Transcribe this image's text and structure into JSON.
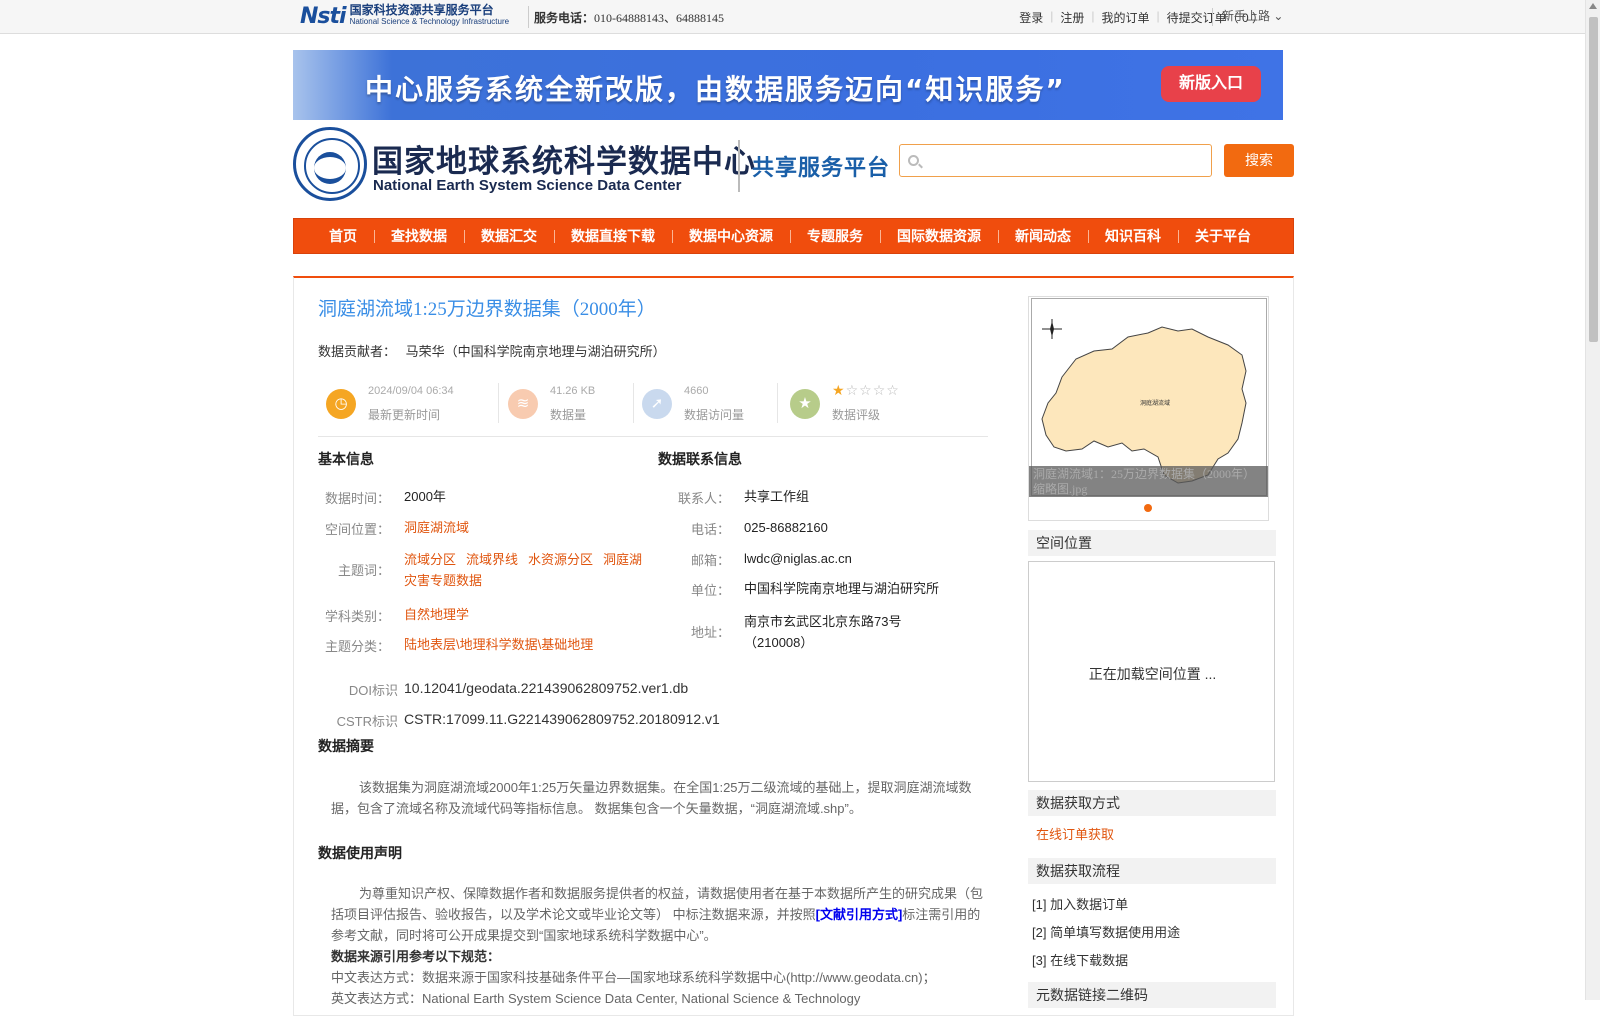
{
  "topbar": {
    "logo_mark": "Nsti",
    "logo_cn": "国家科技资源共享服务平台",
    "logo_en": "National Science & Technology Infrastructure",
    "phone_label": "服务电话：",
    "phone_value": "010-64888143、64888145",
    "links": [
      "登录",
      "注册",
      "我的订单",
      "待提交订单（ 0 ）"
    ],
    "newbie": "新手上路 ⌄"
  },
  "banner": {
    "text": "中心服务系统全新改版，由数据服务迈向“知识服务”",
    "button": "新版入口"
  },
  "brand": {
    "cn": "国家地球系统科学数据中心",
    "en": "National Earth System Science Data Center",
    "sub": "共享服务平台"
  },
  "search": {
    "placeholder": "",
    "button": "搜索"
  },
  "nav": [
    "首页",
    "查找数据",
    "数据汇交",
    "数据直接下载",
    "数据中心资源",
    "专题服务",
    "国际数据资源",
    "新闻动态",
    "知识百科",
    "关于平台"
  ],
  "dataset": {
    "title": "洞庭湖流域1:25万边界数据集（2000年）",
    "contributor_label": "数据贡献者：",
    "contributor": "马荣华（中国科学院南京地理与湖泊研究所）",
    "stats": [
      {
        "value": "2024/09/04 06:34",
        "label": "最新更新时间",
        "icon": "clock-icon",
        "color": "#f5a623"
      },
      {
        "value": "41.26 KB",
        "label": "数据量",
        "icon": "layers-icon",
        "color": "#f8cbb0"
      },
      {
        "value": "4660",
        "label": "数据访问量",
        "icon": "cursor-icon",
        "color": "#c9d9ee"
      },
      {
        "value": "",
        "label": "数据评级",
        "icon": "star-badge-icon",
        "color": "#b7cc8a"
      }
    ],
    "rating": 1,
    "rating_max": 5
  },
  "basic_info": {
    "heading": "基本信息",
    "time_label": "数据时间：",
    "time_value": "2000年",
    "location_label": "空间位置：",
    "location_value": "洞庭湖流域",
    "keywords_label": "主题词：",
    "keywords": [
      "流域分区",
      "流域界线",
      "水资源分区",
      "洞庭湖灾害专题数据"
    ],
    "discipline_label": "学科类别：",
    "discipline_value": "自然地理学",
    "category_label": "主题分类：",
    "category_value": "陆地表层\\地理科学数据\\基础地理",
    "doi_label": "DOI标识",
    "doi_value": "10.12041/geodata.221439062809752.ver1.db",
    "cstr_label": "CSTR标识",
    "cstr_value": "CSTR:17099.11.G221439062809752.20180912.v1"
  },
  "contact_info": {
    "heading": "数据联系信息",
    "contact_label": "联系人：",
    "contact_value": "共享工作组",
    "phone_label": "电话：",
    "phone_value": "025-86882160",
    "email_label": "邮箱：",
    "email_value": "lwdc@niglas.ac.cn",
    "unit_label": "单位：",
    "unit_value": "中国科学院南京地理与湖泊研究所",
    "address_label": "地址：",
    "address_value": "南京市玄武区北京东路73号（210008）"
  },
  "abstract": {
    "heading": "数据摘要",
    "text": "该数据集为洞庭湖流域2000年1:25万矢量边界数据集。在全国1:25万二级流域的基础上，提取洞庭湖流域数据，包含了流域名称及流域代码等指标信息。 数据集包含一个矢量数据，“洞庭湖流域.shp”。"
  },
  "usage": {
    "heading": "数据使用声明",
    "text_before": "为尊重知识产权、保障数据作者和数据服务提供者的权益，请数据使用者在基于本数据所产生的研究成果（包括项目评估报告、验收报告，以及学术论文或毕业论文等） 中标注数据来源，并按照",
    "cite_link": "[文献引用方式]",
    "text_after": "标注需引用的参考文献，同时将可公开成果提交到“国家地球系统科学数据中心”。",
    "ref_heading": "数据来源引用参考以下规范：",
    "cn_line": "中文表达方式：数据来源于国家科技基础条件平台—国家地球系统科学数据中心(http://www.geodata.cn)；",
    "en_line": "英文表达方式：National Earth System Science Data Center, National Science & Technology"
  },
  "sidebar": {
    "thumb_caption": "洞庭湖流域1：25万边界数据集（2000年） 缩略图.jpg",
    "thumb_label": "洞庭湖流域",
    "spatial_heading": "空间位置",
    "map_loading": "正在加载空间位置 ...",
    "access_heading": "数据获取方式",
    "access_link": "在线订单获取",
    "process_heading": "数据获取流程",
    "steps": [
      "[1] 加入数据订单",
      "[2] 简单填写数据使用用途",
      "[3] 在线下载数据"
    ],
    "qr_heading": "元数据链接二维码"
  }
}
